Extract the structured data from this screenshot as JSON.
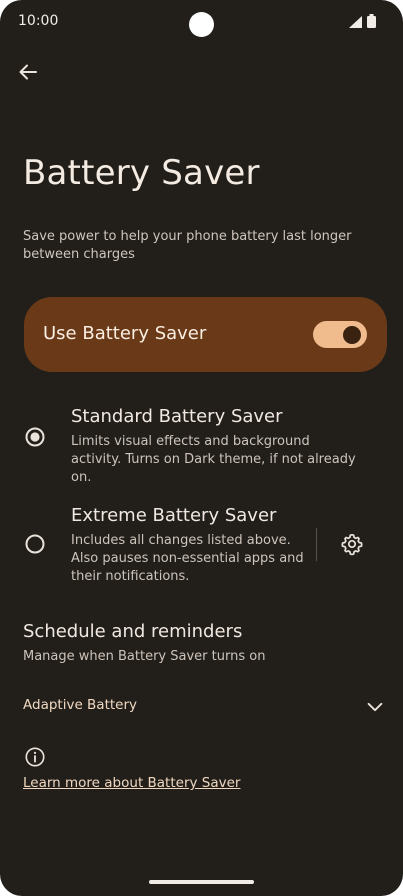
{
  "status_bar": {
    "time": "10:00"
  },
  "page": {
    "title": "Battery Saver",
    "description": "Save power to help your phone battery last longer between charges"
  },
  "main_toggle": {
    "label": "Use Battery Saver",
    "on": true
  },
  "options": [
    {
      "title": "Standard Battery Saver",
      "subtitle": "Limits visual effects and background activity. Turns on Dark theme, if not already on.",
      "selected": true
    },
    {
      "title": "Extreme Battery Saver",
      "subtitle": "Includes all changes listed above. Also pauses non-essential apps and their notifications.",
      "selected": false
    }
  ],
  "schedule": {
    "title": "Schedule and reminders",
    "subtitle": "Manage when Battery Saver turns on"
  },
  "adaptive": {
    "label": "Adaptive Battery"
  },
  "footer": {
    "learn_more": "Learn more about Battery Saver"
  },
  "colors": {
    "background": "#221f1b",
    "toggle_card": "#6a3a18",
    "switch_track": "#f0bb8d",
    "accent_text": "#f0d8c0"
  },
  "icons": [
    "back-arrow-icon",
    "radio-selected-icon",
    "radio-unselected-icon",
    "gear-icon",
    "chevron-down-icon",
    "info-icon",
    "signal-icon",
    "battery-icon"
  ]
}
